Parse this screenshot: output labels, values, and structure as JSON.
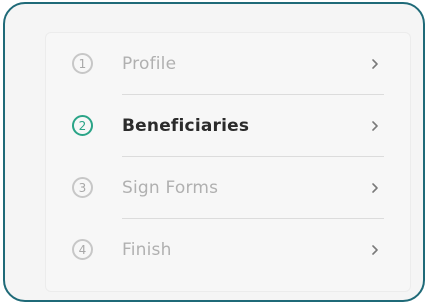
{
  "steps": [
    {
      "number": "1",
      "label": "Profile",
      "state": "inactive"
    },
    {
      "number": "2",
      "label": "Beneficiaries",
      "state": "active"
    },
    {
      "number": "3",
      "label": "Sign Forms",
      "state": "inactive"
    },
    {
      "number": "4",
      "label": "Finish",
      "state": "inactive"
    }
  ],
  "colors": {
    "frame_border": "#1f6a78",
    "active_accent": "#2aa487",
    "inactive_text": "#b0b0b0",
    "active_text": "#2b2b2b"
  },
  "icons": {
    "step_arrow": "chevron-right-icon"
  }
}
